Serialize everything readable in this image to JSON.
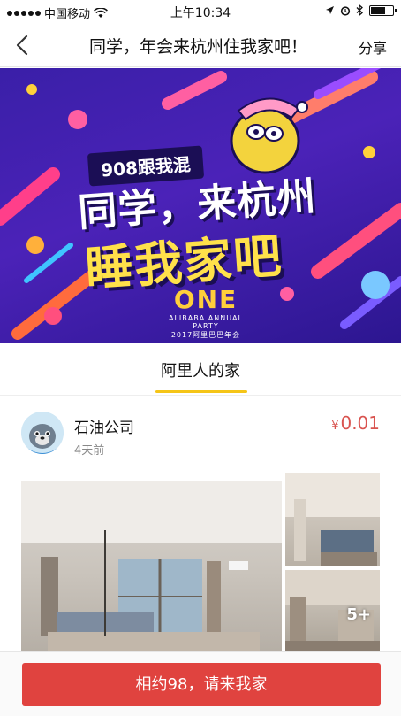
{
  "status_bar": {
    "carrier": "中国移动",
    "time": "上午10:34"
  },
  "nav": {
    "title": "同学，年会来杭州住我家吧！",
    "share_label": "分享"
  },
  "banner": {
    "tag": "908跟我混",
    "line1": "同学，来杭州",
    "line2": "睡我家吧",
    "logo_mark": "ONE",
    "logo_sub1": "ALIBABA ANNUAL PARTY",
    "logo_sub2": "2017阿里巴巴年会"
  },
  "section": {
    "label": "阿里人的家"
  },
  "post": {
    "user_name": "石油公司",
    "posted": "4天前",
    "currency": "¥",
    "price": "0.01",
    "more_photos": "5+"
  },
  "action": {
    "cta_label": "相约98，请来我家"
  },
  "colors": {
    "accent_red": "#e0433f",
    "tab_underline": "#f5c518",
    "banner_purple": "#3a1fa8",
    "banner_yellow": "#ffe14a"
  }
}
